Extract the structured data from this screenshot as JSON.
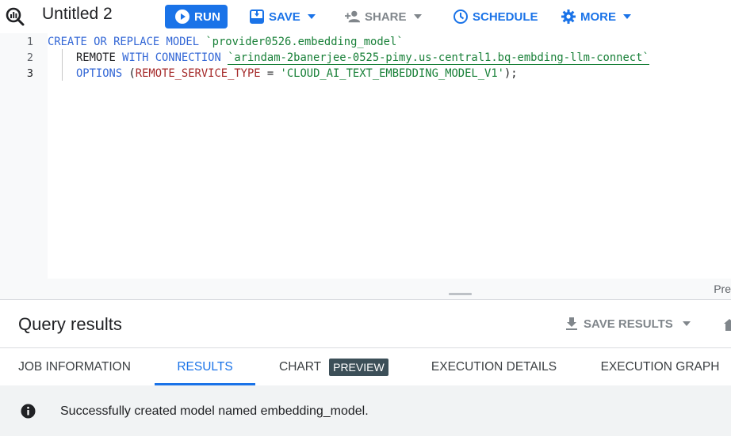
{
  "toolbar": {
    "tab_title": "Untitled 2",
    "run_label": "RUN",
    "save_label": "SAVE",
    "share_label": "SHARE",
    "schedule_label": "SCHEDULE",
    "more_label": "MORE",
    "accent_color": "#1a73e8"
  },
  "editor": {
    "line_numbers": [
      "1",
      "2",
      "3"
    ],
    "lines": {
      "l1": {
        "kw": "CREATE OR REPLACE MODEL",
        "ident": "`provider0526.embedding_model`"
      },
      "l2": {
        "plain": "REMOTE",
        "kw": "WITH CONNECTION",
        "ident": "`arindam-2banerjee-0525-pimy.us-central1.bq-embding-llm-connect`"
      },
      "l3": {
        "kw": "OPTIONS",
        "open": " (",
        "param": "REMOTE_SERVICE_TYPE",
        "eq": " = ",
        "str": "'CLOUD_AI_TEXT_EMBEDDING_MODEL_V1'",
        "close": ");"
      }
    },
    "overflow_label": "Pre"
  },
  "results": {
    "title": "Query results",
    "save_results_label": "SAVE RESULTS",
    "tabs": {
      "job_information": "JOB INFORMATION",
      "results": "RESULTS",
      "chart": "CHART",
      "chart_badge": "PREVIEW",
      "execution_details": "EXECUTION DETAILS",
      "execution_graph": "EXECUTION GRAPH"
    },
    "message": "Successfully created model named embedding_model."
  },
  "icons": {
    "tab_icon": "query-icon",
    "run": "play-circle-icon",
    "save": "save-icon",
    "share": "person-add-icon",
    "schedule": "clock-icon",
    "more": "gear-icon",
    "save_results": "download-icon",
    "info": "info-icon"
  }
}
